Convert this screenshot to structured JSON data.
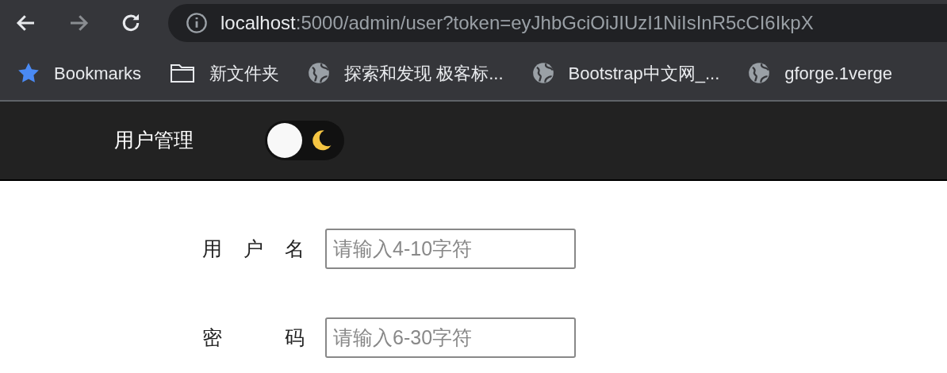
{
  "browser": {
    "address": {
      "host": "localhost",
      "path": ":5000/admin/user?token=eyJhbGciOiJIUzI1NiIsInR5cCI6IkpX"
    },
    "bookmarks": [
      {
        "kind": "star",
        "label": "Bookmarks"
      },
      {
        "kind": "folder",
        "label": "新文件夹"
      },
      {
        "kind": "globe",
        "label": "探索和发现 极客标..."
      },
      {
        "kind": "globe",
        "label": "Bootstrap中文网_..."
      },
      {
        "kind": "globe",
        "label": "gforge.1verge"
      }
    ]
  },
  "header": {
    "title": "用户管理",
    "dark_mode_toggle": {
      "on": false
    }
  },
  "form": {
    "fields": [
      {
        "label": "用户名",
        "placeholder": "请输入4-10字符"
      },
      {
        "label": "密码",
        "placeholder": "请输入6-30字符"
      }
    ]
  }
}
